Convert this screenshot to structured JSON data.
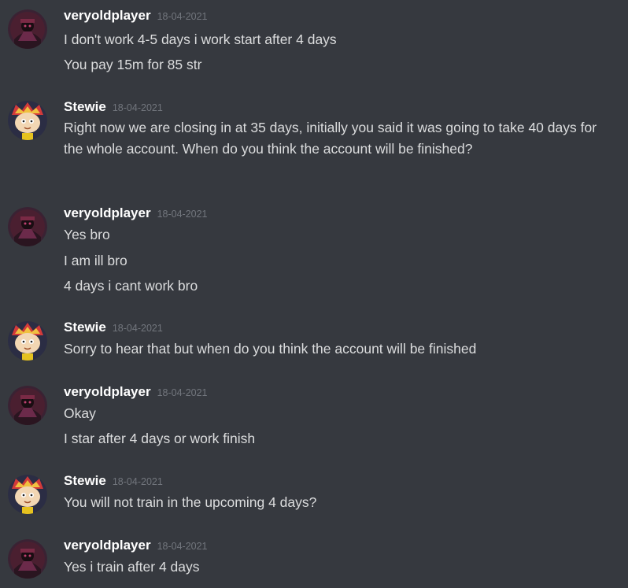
{
  "colors": {
    "background": "#36393f",
    "author": "#ffffff",
    "timestamp": "#72767d",
    "text": "#dcddde"
  },
  "messages": [
    {
      "author": "veryoldplayer",
      "avatar": "veryoldplayer-avatar",
      "timestamp": "18-04-2021",
      "lines": [
        "I don't work 4-5 days i work start after 4 days",
        "You pay 15m for 85 str"
      ]
    },
    {
      "author": "Stewie",
      "avatar": "stewie-avatar",
      "timestamp": "18-04-2021",
      "lines": [
        "Right now we are closing in at 35 days, initially you said it was going to take 40 days for the whole account. When do you think the account will be finished?"
      ]
    },
    {
      "author": "veryoldplayer",
      "avatar": "veryoldplayer-avatar",
      "timestamp": "18-04-2021",
      "lines": [
        "Yes bro",
        "I am ill bro",
        "4 days i cant work bro"
      ]
    },
    {
      "author": "Stewie",
      "avatar": "stewie-avatar",
      "timestamp": "18-04-2021",
      "lines": [
        "Sorry to hear that but when do you think the account will be finished"
      ]
    },
    {
      "author": "veryoldplayer",
      "avatar": "veryoldplayer-avatar",
      "timestamp": "18-04-2021",
      "lines": [
        "Okay",
        "I star after 4 days or work finish"
      ]
    },
    {
      "author": "Stewie",
      "avatar": "stewie-avatar",
      "timestamp": "18-04-2021",
      "lines": [
        "You will not train in the upcoming 4 days?"
      ]
    },
    {
      "author": "veryoldplayer",
      "avatar": "veryoldplayer-avatar",
      "timestamp": "18-04-2021",
      "lines": [
        "Yes i train after 4 days"
      ]
    }
  ]
}
